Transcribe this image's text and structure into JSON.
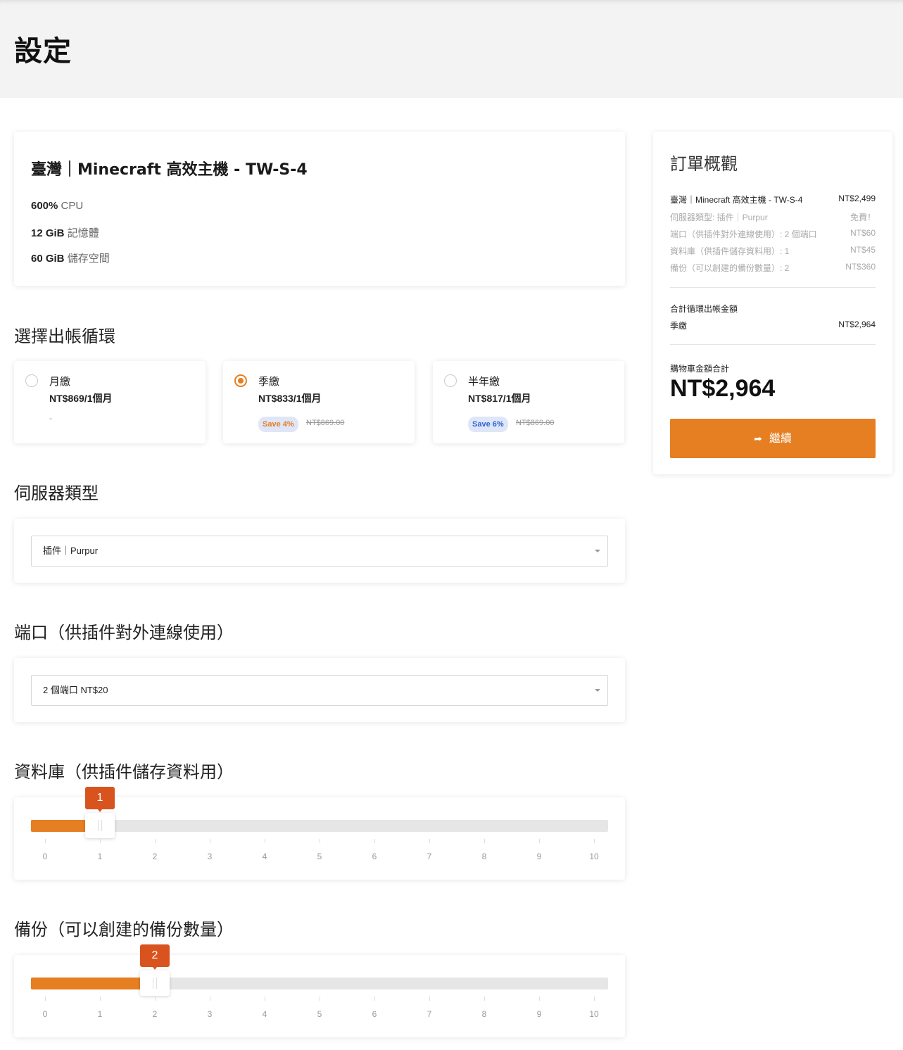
{
  "header": {
    "title": "設定"
  },
  "product": {
    "name": "臺灣｜Minecraft 高效主機 - TW-S-4",
    "specs": [
      {
        "value": "600%",
        "label": "CPU"
      },
      {
        "value": "12 GiB",
        "label": "記憶體"
      },
      {
        "value": "60 GiB",
        "label": "儲存空間"
      }
    ]
  },
  "billing": {
    "title": "選擇出帳循環",
    "options": [
      {
        "label": "月繳",
        "price": "NT$869/1個月",
        "note": "-",
        "selected": false
      },
      {
        "label": "季繳",
        "price": "NT$833/1個月",
        "save": "Save 4%",
        "old_price": "NT$869.00",
        "selected": true
      },
      {
        "label": "半年繳",
        "price": "NT$817/1個月",
        "save": "Save 6%",
        "old_price": "NT$869.00",
        "selected": false
      }
    ]
  },
  "server_type": {
    "title": "伺服器類型",
    "value": "插件｜Purpur"
  },
  "ports": {
    "title": "端口（供插件對外連線使用）",
    "value": "2 個端口 NT$20"
  },
  "database": {
    "title": "資料庫（供插件儲存資料用）",
    "value": "1",
    "level": 1,
    "min": 0,
    "max": 10
  },
  "backup": {
    "title": "備份（可以創建的備份數量）",
    "value": "2",
    "level": 2,
    "min": 0,
    "max": 10
  },
  "ticks": [
    "0",
    "1",
    "2",
    "3",
    "4",
    "5",
    "6",
    "7",
    "8",
    "9",
    "10"
  ],
  "summary": {
    "title": "訂單概觀",
    "items": [
      {
        "label": "臺灣｜Minecraft 高效主機 - TW-S-4",
        "value": "NT$2,499"
      },
      {
        "label": "伺服器類型: 插件｜Purpur",
        "value": "免費！"
      },
      {
        "label": "端口（供插件對外連線使用）: 2 個端口",
        "value": "NT$60"
      },
      {
        "label": "資料庫（供插件儲存資料用）: 1",
        "value": "NT$45"
      },
      {
        "label": "備份（可以創建的備份數量）: 2",
        "value": "NT$360"
      }
    ],
    "recurring_label": "合計循環出帳金額",
    "cycle": "季繳",
    "cycle_amount": "NT$2,964",
    "total_label": "購物車金額合計",
    "total": "NT$2,964",
    "continue_label": "繼續"
  },
  "colors": {
    "accent": "#e67e22",
    "bubble": "#d9531e",
    "save_blue": "#2f63d8"
  }
}
